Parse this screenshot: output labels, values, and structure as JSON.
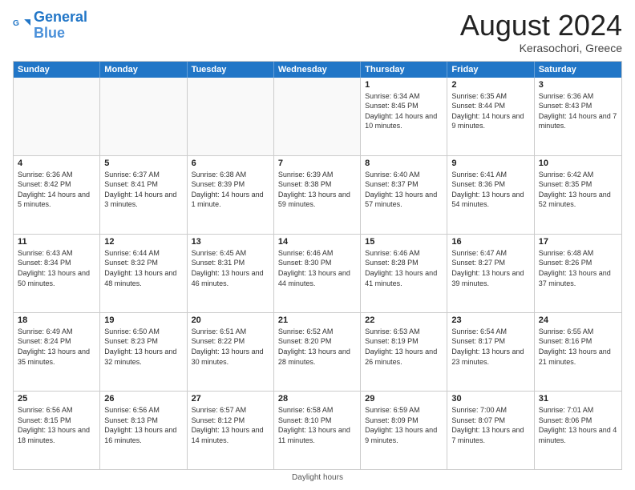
{
  "header": {
    "logo_line1": "General",
    "logo_line2": "Blue",
    "month_title": "August 2024",
    "location": "Kerasochori, Greece"
  },
  "weekdays": [
    "Sunday",
    "Monday",
    "Tuesday",
    "Wednesday",
    "Thursday",
    "Friday",
    "Saturday"
  ],
  "rows": [
    [
      {
        "day": "",
        "info": "",
        "empty": true
      },
      {
        "day": "",
        "info": "",
        "empty": true
      },
      {
        "day": "",
        "info": "",
        "empty": true
      },
      {
        "day": "",
        "info": "",
        "empty": true
      },
      {
        "day": "1",
        "info": "Sunrise: 6:34 AM\nSunset: 8:45 PM\nDaylight: 14 hours\nand 10 minutes."
      },
      {
        "day": "2",
        "info": "Sunrise: 6:35 AM\nSunset: 8:44 PM\nDaylight: 14 hours\nand 9 minutes."
      },
      {
        "day": "3",
        "info": "Sunrise: 6:36 AM\nSunset: 8:43 PM\nDaylight: 14 hours\nand 7 minutes."
      }
    ],
    [
      {
        "day": "4",
        "info": "Sunrise: 6:36 AM\nSunset: 8:42 PM\nDaylight: 14 hours\nand 5 minutes."
      },
      {
        "day": "5",
        "info": "Sunrise: 6:37 AM\nSunset: 8:41 PM\nDaylight: 14 hours\nand 3 minutes."
      },
      {
        "day": "6",
        "info": "Sunrise: 6:38 AM\nSunset: 8:39 PM\nDaylight: 14 hours\nand 1 minute."
      },
      {
        "day": "7",
        "info": "Sunrise: 6:39 AM\nSunset: 8:38 PM\nDaylight: 13 hours\nand 59 minutes."
      },
      {
        "day": "8",
        "info": "Sunrise: 6:40 AM\nSunset: 8:37 PM\nDaylight: 13 hours\nand 57 minutes."
      },
      {
        "day": "9",
        "info": "Sunrise: 6:41 AM\nSunset: 8:36 PM\nDaylight: 13 hours\nand 54 minutes."
      },
      {
        "day": "10",
        "info": "Sunrise: 6:42 AM\nSunset: 8:35 PM\nDaylight: 13 hours\nand 52 minutes."
      }
    ],
    [
      {
        "day": "11",
        "info": "Sunrise: 6:43 AM\nSunset: 8:34 PM\nDaylight: 13 hours\nand 50 minutes."
      },
      {
        "day": "12",
        "info": "Sunrise: 6:44 AM\nSunset: 8:32 PM\nDaylight: 13 hours\nand 48 minutes."
      },
      {
        "day": "13",
        "info": "Sunrise: 6:45 AM\nSunset: 8:31 PM\nDaylight: 13 hours\nand 46 minutes."
      },
      {
        "day": "14",
        "info": "Sunrise: 6:46 AM\nSunset: 8:30 PM\nDaylight: 13 hours\nand 44 minutes."
      },
      {
        "day": "15",
        "info": "Sunrise: 6:46 AM\nSunset: 8:28 PM\nDaylight: 13 hours\nand 41 minutes."
      },
      {
        "day": "16",
        "info": "Sunrise: 6:47 AM\nSunset: 8:27 PM\nDaylight: 13 hours\nand 39 minutes."
      },
      {
        "day": "17",
        "info": "Sunrise: 6:48 AM\nSunset: 8:26 PM\nDaylight: 13 hours\nand 37 minutes."
      }
    ],
    [
      {
        "day": "18",
        "info": "Sunrise: 6:49 AM\nSunset: 8:24 PM\nDaylight: 13 hours\nand 35 minutes."
      },
      {
        "day": "19",
        "info": "Sunrise: 6:50 AM\nSunset: 8:23 PM\nDaylight: 13 hours\nand 32 minutes."
      },
      {
        "day": "20",
        "info": "Sunrise: 6:51 AM\nSunset: 8:22 PM\nDaylight: 13 hours\nand 30 minutes."
      },
      {
        "day": "21",
        "info": "Sunrise: 6:52 AM\nSunset: 8:20 PM\nDaylight: 13 hours\nand 28 minutes."
      },
      {
        "day": "22",
        "info": "Sunrise: 6:53 AM\nSunset: 8:19 PM\nDaylight: 13 hours\nand 26 minutes."
      },
      {
        "day": "23",
        "info": "Sunrise: 6:54 AM\nSunset: 8:17 PM\nDaylight: 13 hours\nand 23 minutes."
      },
      {
        "day": "24",
        "info": "Sunrise: 6:55 AM\nSunset: 8:16 PM\nDaylight: 13 hours\nand 21 minutes."
      }
    ],
    [
      {
        "day": "25",
        "info": "Sunrise: 6:56 AM\nSunset: 8:15 PM\nDaylight: 13 hours\nand 18 minutes."
      },
      {
        "day": "26",
        "info": "Sunrise: 6:56 AM\nSunset: 8:13 PM\nDaylight: 13 hours\nand 16 minutes."
      },
      {
        "day": "27",
        "info": "Sunrise: 6:57 AM\nSunset: 8:12 PM\nDaylight: 13 hours\nand 14 minutes."
      },
      {
        "day": "28",
        "info": "Sunrise: 6:58 AM\nSunset: 8:10 PM\nDaylight: 13 hours\nand 11 minutes."
      },
      {
        "day": "29",
        "info": "Sunrise: 6:59 AM\nSunset: 8:09 PM\nDaylight: 13 hours\nand 9 minutes."
      },
      {
        "day": "30",
        "info": "Sunrise: 7:00 AM\nSunset: 8:07 PM\nDaylight: 13 hours\nand 7 minutes."
      },
      {
        "day": "31",
        "info": "Sunrise: 7:01 AM\nSunset: 8:06 PM\nDaylight: 13 hours\nand 4 minutes."
      }
    ]
  ],
  "footer": "Daylight hours"
}
